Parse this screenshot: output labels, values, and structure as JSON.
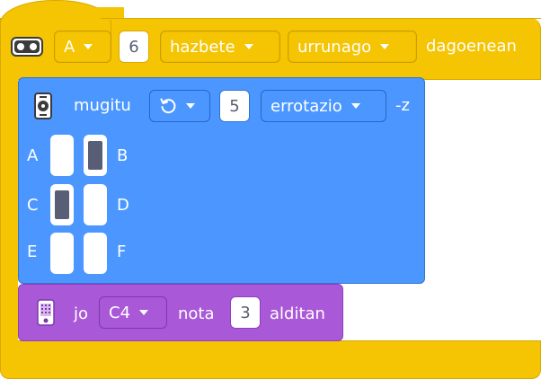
{
  "event_block": {
    "sensor_icon": "distance-sensor-icon",
    "port_value": "A",
    "distance_value": "6",
    "unit_value": "hazbete",
    "comparison_value": "urrunago",
    "suffix_label": "dagoenean"
  },
  "motor_block": {
    "icon": "motor-pair-icon",
    "action_label": "mugitu",
    "direction_icon": "rotate-counterclockwise-icon",
    "amount_value": "5",
    "unit_value": "errotazio",
    "suffix_label": "-z",
    "ports": [
      {
        "label": "A",
        "selected": false
      },
      {
        "label": "B",
        "selected": true
      },
      {
        "label": "C",
        "selected": true
      },
      {
        "label": "D",
        "selected": false
      },
      {
        "label": "E",
        "selected": false
      },
      {
        "label": "F",
        "selected": false
      }
    ]
  },
  "sound_block": {
    "icon": "hub-speaker-icon",
    "action_label": "jo",
    "note_value": "C4",
    "middle_label": "nota",
    "count_value": "3",
    "suffix_label": "alditan"
  },
  "colors": {
    "event_yellow": "#f5c402",
    "motor_blue": "#4c97ff",
    "sound_purple": "#a958d7",
    "field_text": "#575e75"
  }
}
